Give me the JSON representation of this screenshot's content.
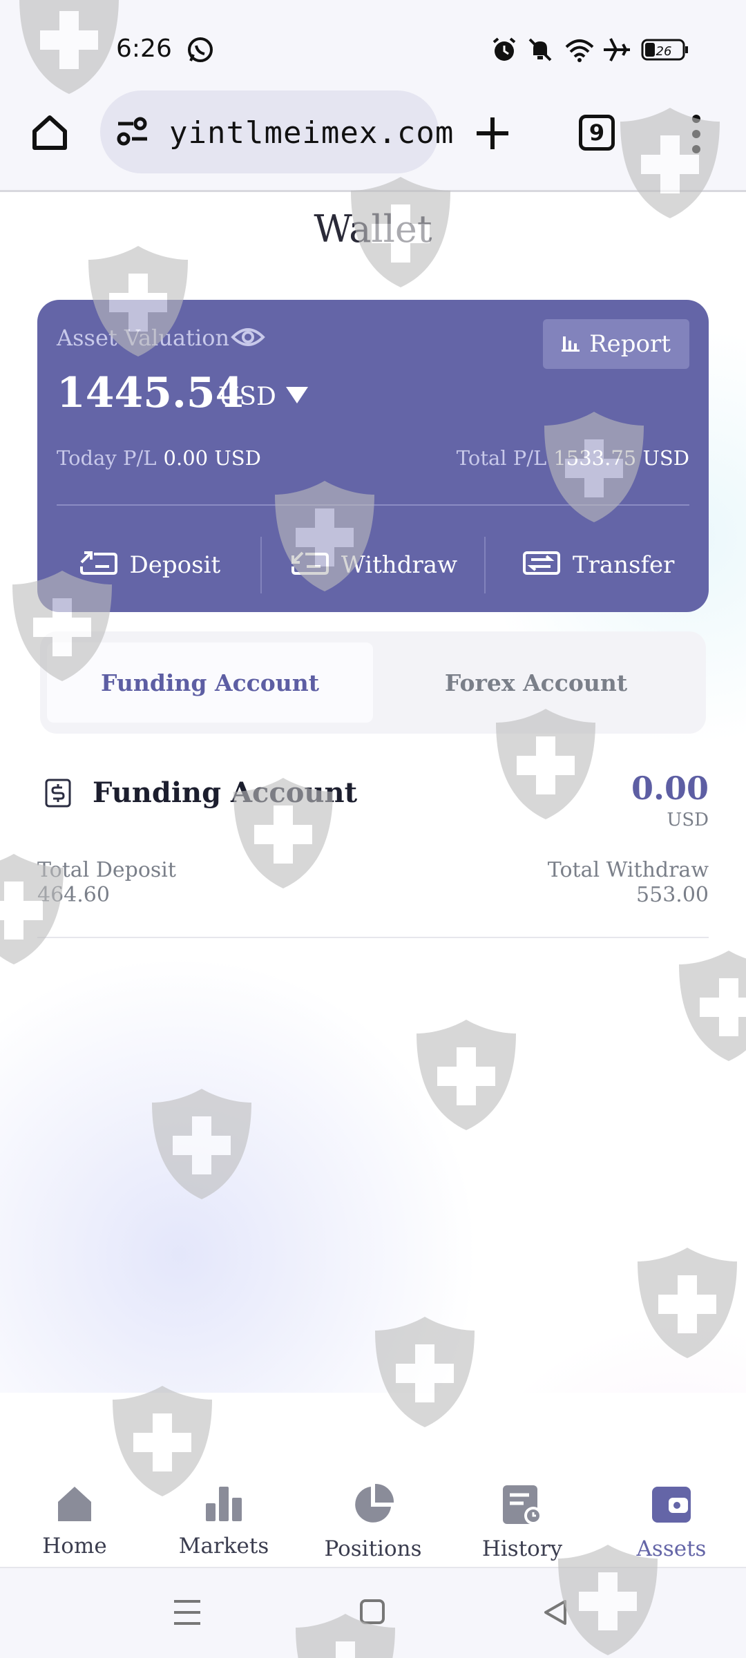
{
  "status_bar": {
    "time": "6:26",
    "battery": "26",
    "icons": [
      "whatsapp-icon",
      "alarm-icon",
      "bell-muted-icon",
      "wifi-icon",
      "airplane-icon",
      "battery-icon"
    ]
  },
  "browser": {
    "url": "yintlmeimex.com",
    "tab_count": "9",
    "icons": [
      "home-icon",
      "site-settings-icon",
      "new-tab-icon",
      "tabs-icon",
      "menu-icon"
    ]
  },
  "page": {
    "title": "Wallet"
  },
  "wallet_card": {
    "asset_valuation_label": "Asset Valuation",
    "report_label": "Report",
    "balance": "1445.54",
    "currency": "USD",
    "today_pl_label": "Today P/L",
    "today_pl_value": "0.00 USD",
    "total_pl_label": "Total P/L",
    "total_pl_value": "1533.75 USD",
    "actions": {
      "deposit": "Deposit",
      "withdraw": "Withdraw",
      "transfer": "Transfer"
    },
    "color": "#6465a7"
  },
  "account_tabs": {
    "funding": "Funding Account",
    "forex": "Forex Account",
    "active": "funding"
  },
  "funding_account": {
    "title": "Funding Account",
    "amount": "0.00",
    "unit": "USD",
    "total_deposit_label": "Total Deposit",
    "total_deposit_value": "464.60",
    "total_withdraw_label": "Total Withdraw",
    "total_withdraw_value": "553.00"
  },
  "bottom_nav": {
    "home": "Home",
    "markets": "Markets",
    "positions": "Positions",
    "history": "History",
    "assets": "Assets",
    "active": "assets",
    "active_color": "#6465a7"
  }
}
